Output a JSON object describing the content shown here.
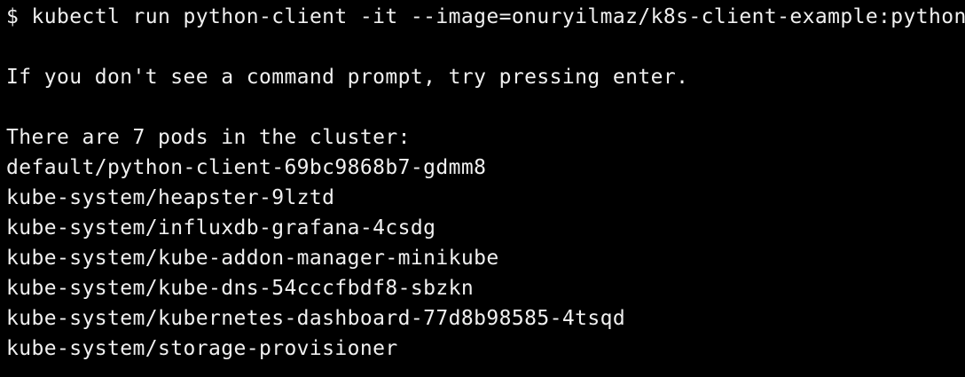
{
  "terminal": {
    "background": "#000000",
    "foreground": "#f0f0f0",
    "prompt_symbol": "$",
    "command": "kubectl run python-client -it --image=onuryilmaz/k8s-client-example:python",
    "notice": "If you don't see a command prompt, try pressing enter.",
    "summary": "There are 7 pods in the cluster:",
    "pods": [
      "default/python-client-69bc9868b7-gdmm8",
      "kube-system/heapster-9lztd",
      "kube-system/influxdb-grafana-4csdg",
      "kube-system/kube-addon-manager-minikube",
      "kube-system/kube-dns-54cccfbdf8-sbzkn",
      "kube-system/kubernetes-dashboard-77d8b98585-4tsqd",
      "kube-system/storage-provisioner"
    ]
  }
}
